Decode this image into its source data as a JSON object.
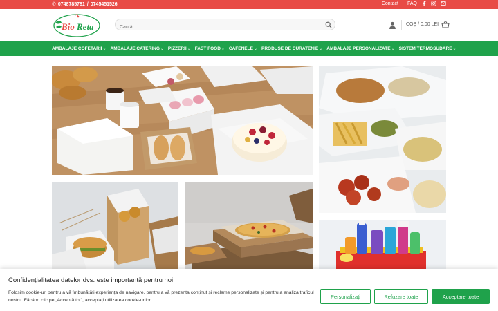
{
  "topbar": {
    "phone1": "0748785781",
    "phone_sep": "/",
    "phone2": "0745451526",
    "links": [
      "Contact",
      "FAQ"
    ],
    "social_icons": [
      "facebook-icon",
      "instagram-icon",
      "email-icon"
    ]
  },
  "header": {
    "logo_text": "BioReta",
    "search_placeholder": "Caută...",
    "cart_label": "Coș / 0.00 lei"
  },
  "nav": {
    "items": [
      {
        "label": "Ambalaje Cofetarii"
      },
      {
        "label": "Ambalaje Catering"
      },
      {
        "label": "Pizzerii"
      },
      {
        "label": "Fast Food"
      },
      {
        "label": "Cafenele"
      },
      {
        "label": "Produse de curatenie"
      },
      {
        "label": "Ambalaje Personalizate"
      },
      {
        "label": "Sistem Termosudare"
      }
    ]
  },
  "tiles": [
    {
      "name": "bakery-packaging-tile",
      "image": "pastry-boxes-photo"
    },
    {
      "name": "catering-packaging-tile",
      "image": "catering-trays-photo"
    },
    {
      "name": "fastfood-packaging-tile",
      "image": "fastfood-boxes-photo"
    },
    {
      "name": "pizza-packaging-tile",
      "image": "pizza-boxes-photo"
    },
    {
      "name": "cleaning-products-tile",
      "image": "cleaning-products-photo"
    }
  ],
  "cookie": {
    "title": "Confidențialitatea datelor dvs. este importantă pentru noi",
    "text": "Folosim cookie-uri pentru a vă îmbunătăți experiența de navigare, pentru a vă prezenta conținut și reclame personalizate și pentru a analiza traficul nostru. Făcând clic pe „Acceptă tot\", acceptați utilizarea cookie-urilor.",
    "btn_customize": "Personalizați",
    "btn_reject": "Refuzare toate",
    "btn_accept": "Acceptare toate"
  },
  "colors": {
    "topbar": "#e84b46",
    "nav": "#1fa24b",
    "accent": "#1fa24b"
  }
}
